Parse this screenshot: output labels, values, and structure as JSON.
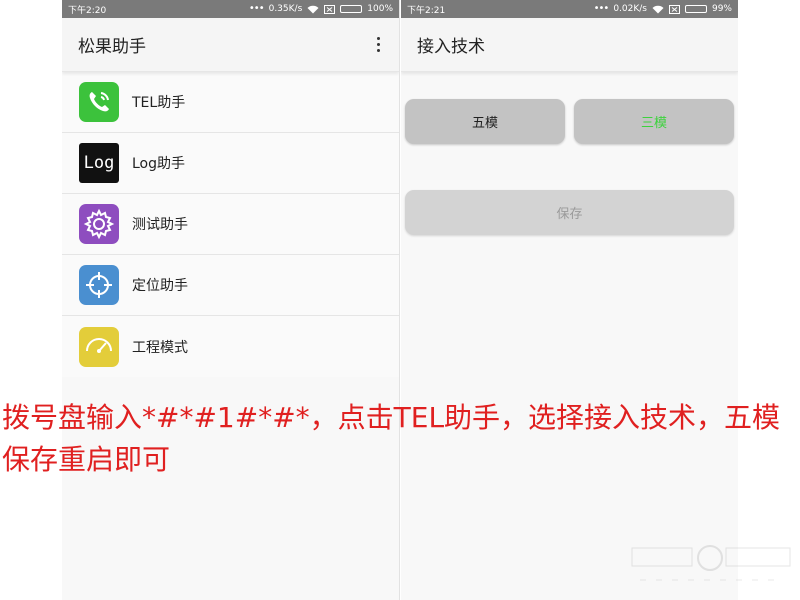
{
  "left_screen": {
    "status_bar": {
      "time": "下午2:20",
      "net_speed": "0.35K/s",
      "battery": "100%",
      "battery_fraction": 1.0
    },
    "title": "松果助手",
    "items": [
      {
        "label": "TEL助手",
        "icon": "phone-icon",
        "color": "#3cc23c"
      },
      {
        "label": "Log助手",
        "icon": "log-icon",
        "color": "#111111",
        "icon_text": "Log"
      },
      {
        "label": "测试助手",
        "icon": "gear-icon",
        "color": "#8e4dbf"
      },
      {
        "label": "定位助手",
        "icon": "crosshair-icon",
        "color": "#4a8fd0"
      },
      {
        "label": "工程模式",
        "icon": "gauge-icon",
        "color": "#e3cd3a"
      }
    ]
  },
  "right_screen": {
    "status_bar": {
      "time": "下午2:21",
      "net_speed": "0.02K/s",
      "battery": "99%",
      "battery_fraction": 0.99
    },
    "title": "接入技术",
    "buttons": [
      {
        "label": "五模",
        "color": "#222222"
      },
      {
        "label": "三模",
        "color": "#3dd23d"
      }
    ],
    "save_label": "保存"
  },
  "annotation": {
    "line1": "拨号盘输入*#*#1#*#*，点击TEL助手，选择接入技术，五模",
    "line2": "保存重启即可"
  }
}
